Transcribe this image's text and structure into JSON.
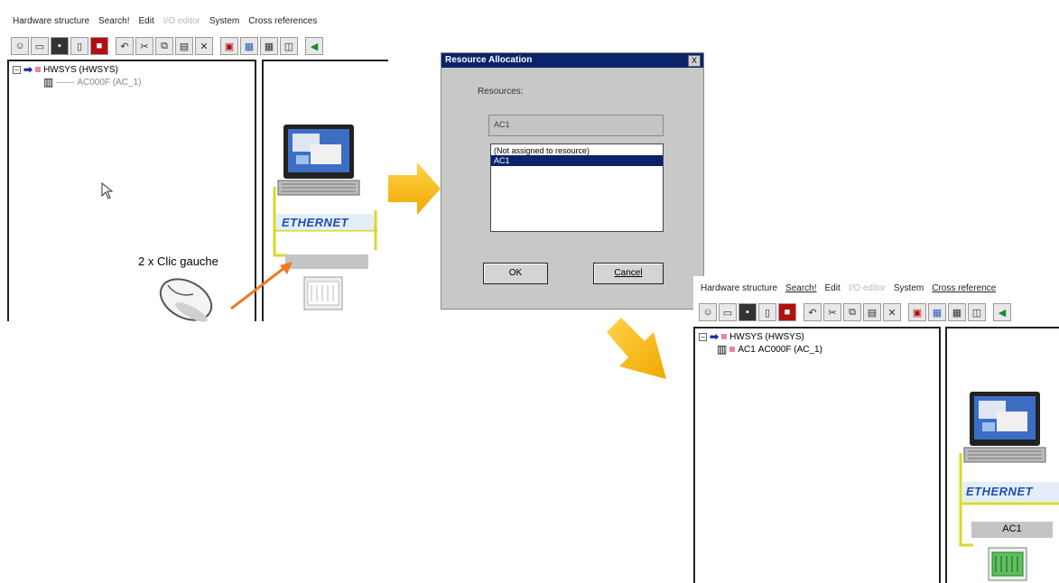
{
  "window1": {
    "menu": [
      "Hardware structure",
      "Search!",
      "Edit",
      "I/O editor",
      "System",
      "Cross references"
    ],
    "tree": {
      "root": "HWSYS (HWSYS)",
      "child": "AC000F (AC_1)"
    }
  },
  "annotation": {
    "label": "2 x Clic gauche"
  },
  "diagram1": {
    "ethernet": "ETHERNET"
  },
  "dialog": {
    "title": "Resource Allocation",
    "close": "X",
    "resources_label": "Resources:",
    "field_value": "AC1",
    "list_items": [
      "(Not assigned to resource)",
      "AC1"
    ],
    "ok": "OK",
    "cancel": "Cancel"
  },
  "window2": {
    "menu": [
      "Hardware structure",
      "Search!",
      "Edit",
      "I/O editor",
      "System",
      "Cross reference"
    ],
    "tree": {
      "root": "HWSYS (HWSYS)",
      "child_resource": "AC1",
      "child": "AC000F (AC_1)"
    }
  },
  "diagram2": {
    "ethernet": "ETHERNET",
    "box_label": "AC1"
  },
  "colors": {
    "accent_arrow": "#f5b800",
    "titlebar": "#0a246a",
    "selection": "#0a246a",
    "mouse_arrow": "#f07a28"
  }
}
